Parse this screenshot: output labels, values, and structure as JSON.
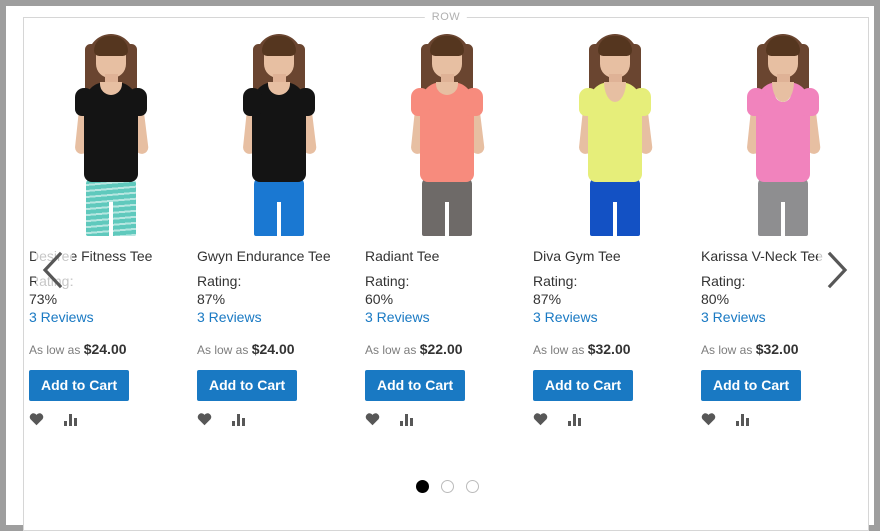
{
  "container": {
    "row_label": "ROW"
  },
  "carousel": {
    "prev_label": "Previous",
    "next_label": "Next",
    "prev_icon": "chevron-left-icon",
    "next_icon": "chevron-right-icon",
    "dots": [
      {
        "label": "1",
        "active": true
      },
      {
        "label": "2",
        "active": false
      },
      {
        "label": "3",
        "active": false
      }
    ],
    "accent_color": "#1979c3",
    "link_color": "#1979c3",
    "muted_color": "#7d7d7d"
  },
  "labels": {
    "rating": "Rating:",
    "as_low_as": "As low as",
    "add_to_cart": "Add to Cart",
    "wishlist_icon": "heart-icon",
    "compare_icon": "compare-bars-icon"
  },
  "products": [
    {
      "name": "Desiree Fitness Tee",
      "rating_label": "Rating:",
      "rating": "73%",
      "reviews": "3 Reviews",
      "price_prefix": "As low as",
      "price": "$24.00",
      "add_to_cart": "Add to Cart",
      "shirt_color": "#141414",
      "bottom_color": "#5fc9bd",
      "striped": true,
      "vneck": false,
      "undershirt": false
    },
    {
      "name": "Gwyn Endurance Tee",
      "rating_label": "Rating:",
      "rating": "87%",
      "reviews": "3 Reviews",
      "price_prefix": "As low as",
      "price": "$24.00",
      "add_to_cart": "Add to Cart",
      "shirt_color": "#141414",
      "bottom_color": "#1a78d2",
      "striped": false,
      "vneck": false,
      "undershirt": false
    },
    {
      "name": "Radiant Tee",
      "rating_label": "Rating:",
      "rating": "60%",
      "reviews": "3 Reviews",
      "price_prefix": "As low as",
      "price": "$22.00",
      "add_to_cart": "Add to Cart",
      "shirt_color": "#f78b7d",
      "bottom_color": "#6e6a68",
      "striped": false,
      "vneck": false,
      "undershirt": false
    },
    {
      "name": "Diva Gym Tee",
      "rating_label": "Rating:",
      "rating": "87%",
      "reviews": "3 Reviews",
      "price_prefix": "As low as",
      "price": "$32.00",
      "add_to_cart": "Add to Cart",
      "shirt_color": "#e6ee7a",
      "bottom_color": "#1351c4",
      "striped": false,
      "vneck": true,
      "undershirt": false
    },
    {
      "name": "Karissa V-Neck Tee",
      "rating_label": "Rating:",
      "rating": "80%",
      "reviews": "3 Reviews",
      "price_prefix": "As low as",
      "price": "$32.00",
      "add_to_cart": "Add to Cart",
      "shirt_color": "#f183bd",
      "bottom_color": "#8e8e90",
      "striped": false,
      "vneck": true,
      "undershirt": true
    }
  ]
}
